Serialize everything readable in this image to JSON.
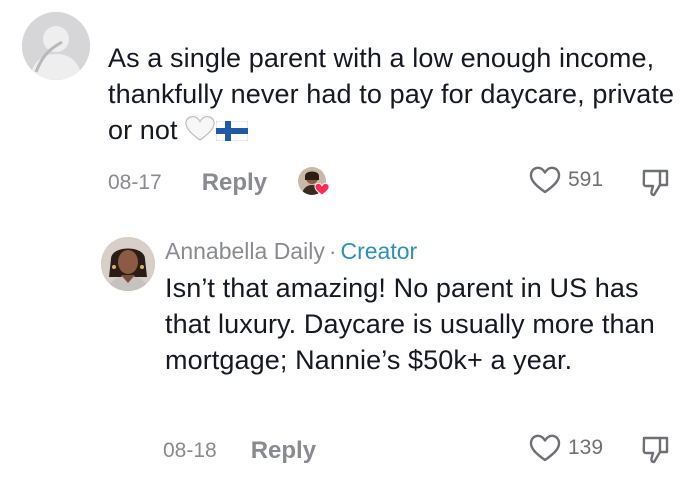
{
  "comments": [
    {
      "text": "As a single parent with a low enough income, thankfully never had to pay for daycare, private or not",
      "emoji": [
        "white-heart",
        "finland-flag"
      ],
      "date": "08-17",
      "reply_label": "Reply",
      "likes": "591",
      "creator_liked": true
    },
    {
      "author": "Annabella Daily",
      "separator": "·",
      "author_badge": "Creator",
      "text": "Isn’t that amazing! No parent in US has that luxury. Daycare is usually more than mortgage; Nannie’s $50k+ a year.",
      "date": "08-18",
      "reply_label": "Reply",
      "likes": "139"
    }
  ],
  "colors": {
    "text": "#161823",
    "meta": "#8a8b91",
    "creator_badge": "#2e8fb7",
    "like_heart_badge": "#fe2c55"
  },
  "icons": {
    "like": "heart-outline-icon",
    "dislike": "thumbs-down-icon",
    "default_avatar": "default-avatar-icon"
  }
}
